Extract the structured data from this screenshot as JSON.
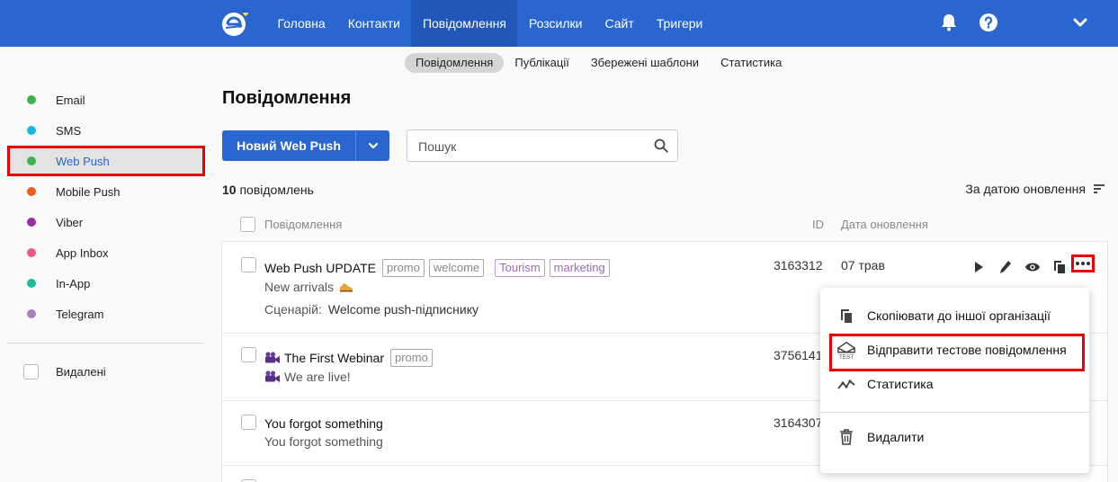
{
  "colors": {
    "primary": "#2a66d0",
    "highlight": "#e00000"
  },
  "topbar": {
    "logo": "app-logo",
    "nav": [
      {
        "label": "Головна",
        "active": false
      },
      {
        "label": "Контакти",
        "active": false
      },
      {
        "label": "Повідомлення",
        "active": true
      },
      {
        "label": "Розсилки",
        "active": false
      },
      {
        "label": "Сайт",
        "active": false
      },
      {
        "label": "Тригери",
        "active": false
      }
    ],
    "icons": [
      "bell-icon",
      "help-icon",
      "chevron-down-icon"
    ]
  },
  "subnav": [
    {
      "label": "Повідомлення",
      "active": true
    },
    {
      "label": "Публікації",
      "active": false
    },
    {
      "label": "Збережені шаблони",
      "active": false
    },
    {
      "label": "Статистика",
      "active": false
    }
  ],
  "sidebar": {
    "items": [
      {
        "label": "Email",
        "color": "#3cb44b"
      },
      {
        "label": "SMS",
        "color": "#1ab6e8"
      },
      {
        "label": "Web Push",
        "color": "#3cb44b",
        "active": true
      },
      {
        "label": "Mobile Push",
        "color": "#f05a1a"
      },
      {
        "label": "Viber",
        "color": "#9c2ca8"
      },
      {
        "label": "App Inbox",
        "color": "#f0568c"
      },
      {
        "label": "In-App",
        "color": "#1abc9c"
      },
      {
        "label": "Telegram",
        "color": "#a87fbf"
      }
    ],
    "deleted_label": "Видалені"
  },
  "main": {
    "title": "Повідомлення",
    "new_button": "Новий Web Push",
    "search_placeholder": "Пошук",
    "count_number": "10",
    "count_label": " повідомлень",
    "sort_label": "За датою оновлення",
    "columns": {
      "message": "Повідомлення",
      "id": "ID",
      "date": "Дата оновлення"
    }
  },
  "rows": [
    {
      "title": "Web Push UPDATE",
      "tags": [
        "promo",
        "welcome"
      ],
      "purple_tags": [
        "Tourism",
        "marketing"
      ],
      "subtitle": "New arrivals",
      "subtitle_icon": "shoe-emoji",
      "scenario_label": "Сценарій:",
      "scenario_value": "Welcome push-підписнику",
      "id": "3163312",
      "date": "07 трав"
    },
    {
      "title": "The First Webinar",
      "title_icon": "video-camera-emoji",
      "tags": [
        "promo"
      ],
      "subtitle": "We are live!",
      "subtitle_icon": "video-camera-emoji",
      "id": "3756141"
    },
    {
      "title": "You forgot something",
      "subtitle": "You forgot something",
      "id": "3164307"
    }
  ],
  "row_actions": [
    "play-icon",
    "edit-icon",
    "preview-icon",
    "copy-icon",
    "more-icon"
  ],
  "menu": {
    "items": [
      {
        "label": "Скопіювати до іншої організації",
        "icon": "copy-icon"
      },
      {
        "label": "Відправити тестове повідомлення",
        "icon": "test-envelope-icon",
        "highlighted": true
      },
      {
        "label": "Статистика",
        "icon": "stats-line-icon"
      },
      {
        "label": "Видалити",
        "icon": "trash-icon"
      }
    ]
  }
}
